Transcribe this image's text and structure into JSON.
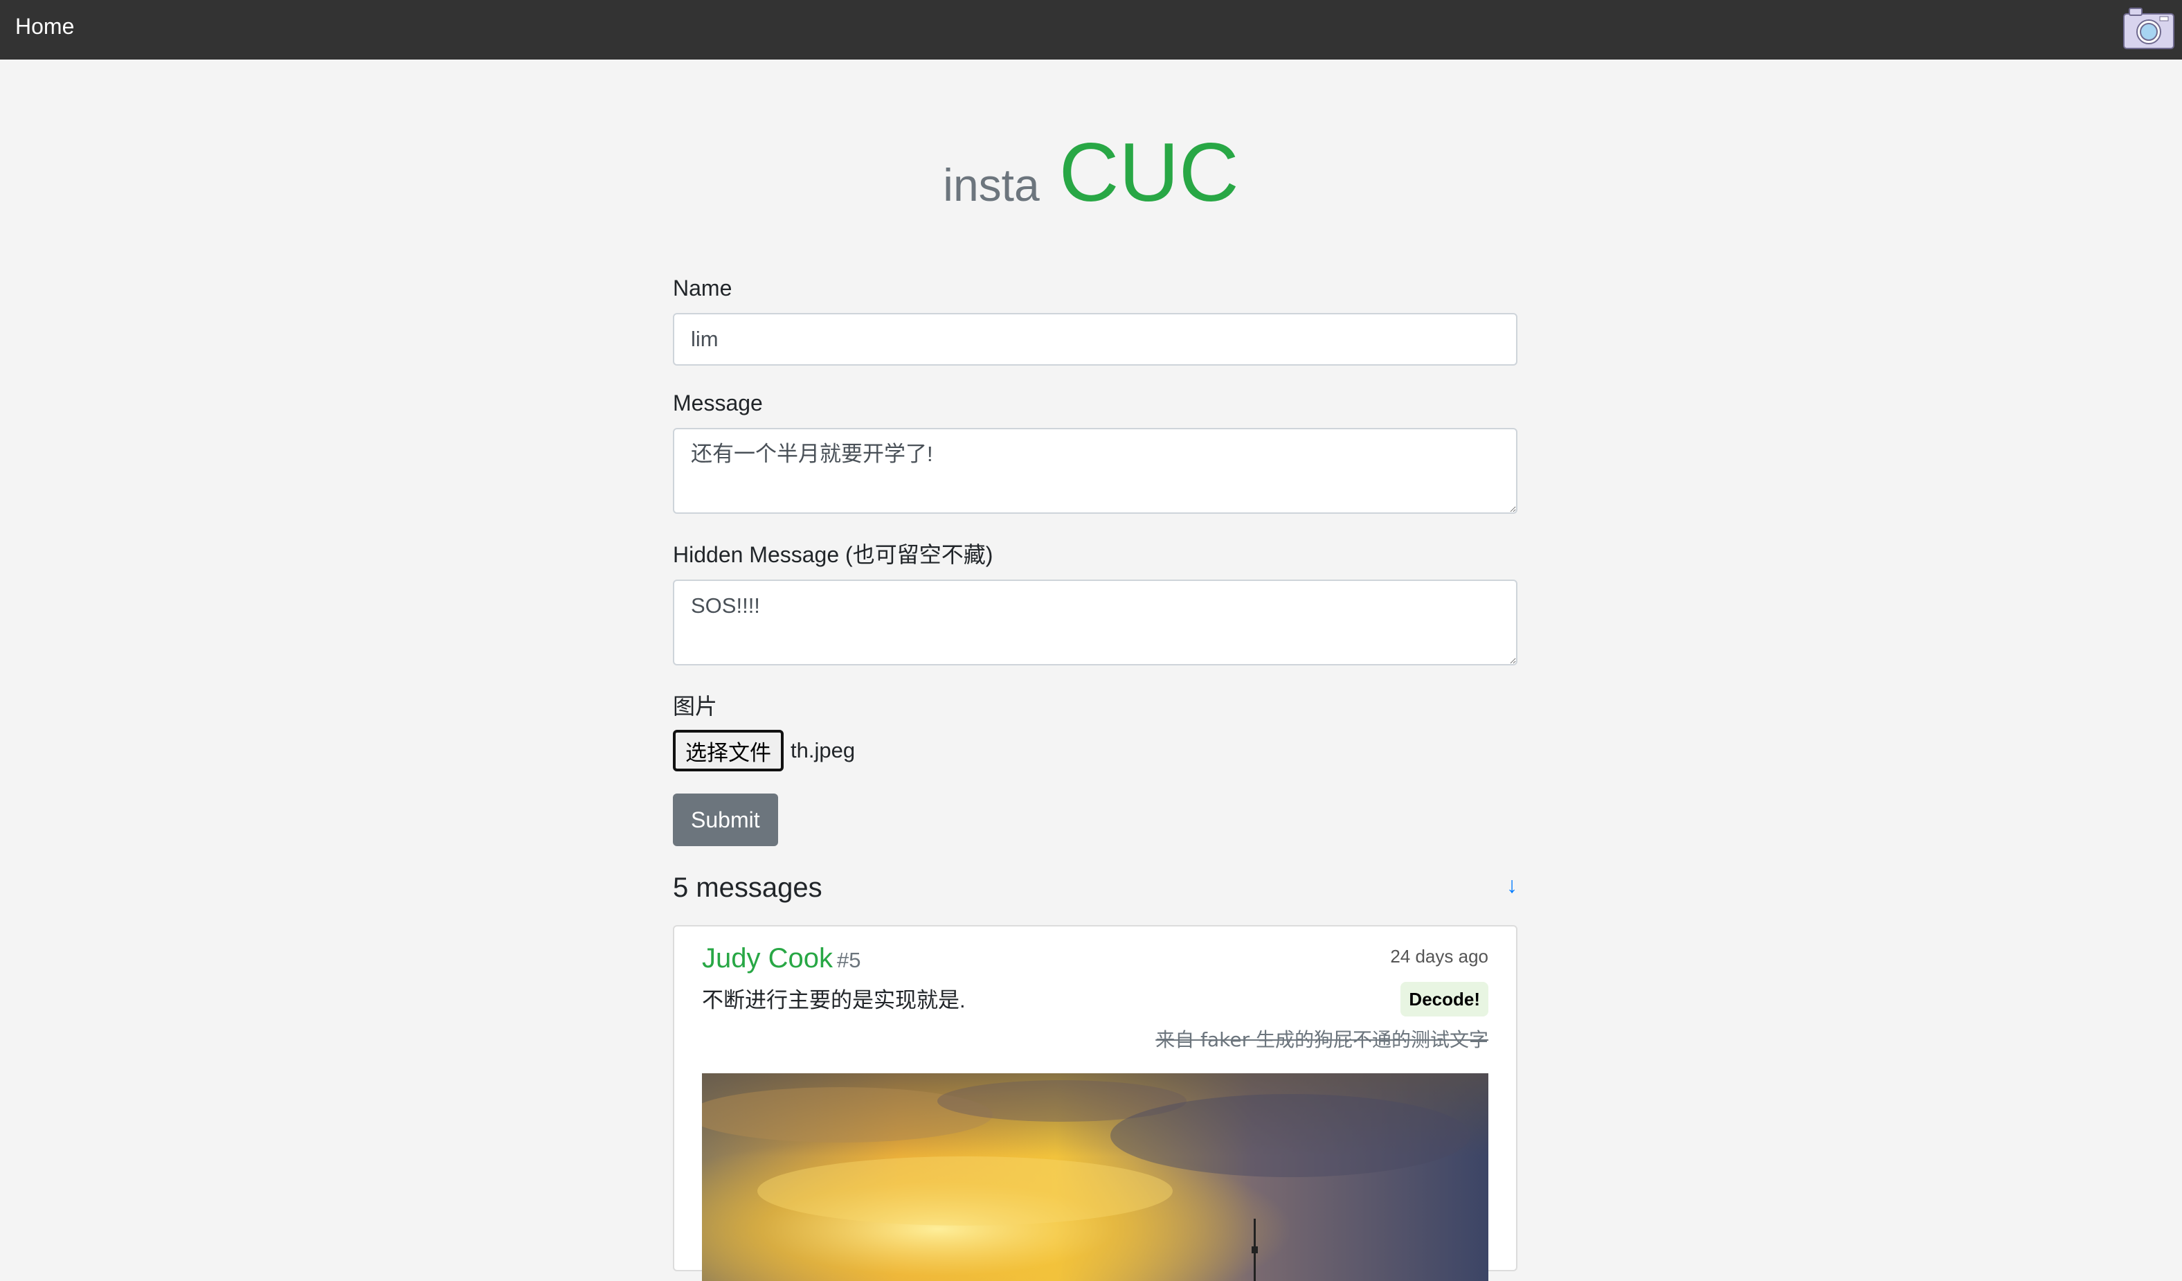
{
  "navbar": {
    "home_label": "Home",
    "camera_icon": "camera-icon"
  },
  "brand": {
    "prefix": "insta",
    "name": "CUC"
  },
  "form": {
    "name_label": "Name",
    "name_value": "lim",
    "message_label": "Message",
    "message_value": "还有一个半月就要开学了!",
    "hidden_label": "Hidden Message (也可留空不藏)",
    "hidden_value": "SOS!!!!",
    "image_label": "图片",
    "file_button_label": "选择文件",
    "file_name": "th.jpeg",
    "submit_label": "Submit"
  },
  "messages": {
    "count_label": "5 messages",
    "scroll_icon": "↓",
    "items": [
      {
        "author": "Judy Cook",
        "id": "#5",
        "time": "24 days ago",
        "body": "不断进行主要的是实现就是.",
        "decode_label": "Decode!",
        "footer": "来自 faker 生成的狗屁不通的测试文字",
        "image_description": "sunset-sky-with-tower"
      }
    ]
  },
  "colors": {
    "navbar_bg": "#333333",
    "accent_green": "#28a745",
    "muted_gray": "#6c757d",
    "link_blue": "#007bff",
    "page_bg": "#f4f4f4"
  }
}
